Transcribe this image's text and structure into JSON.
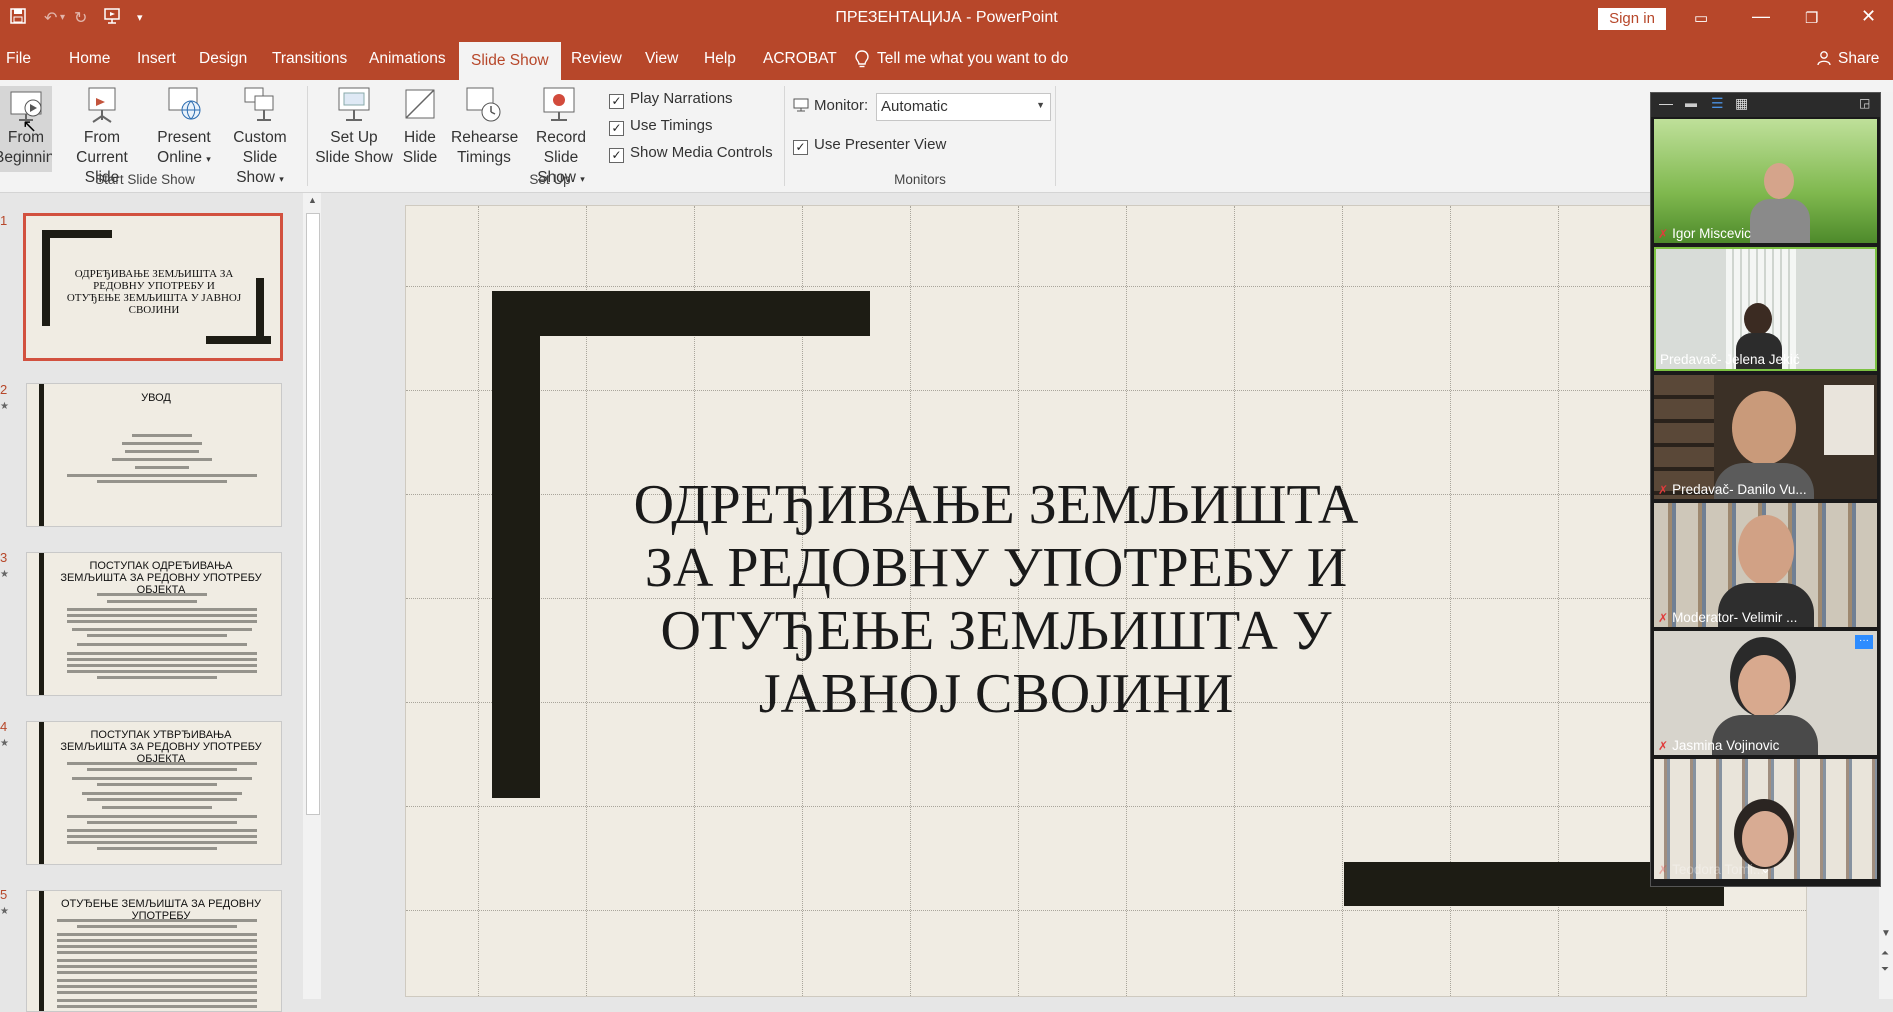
{
  "window": {
    "title": "ПРЕЗЕНТАЦИЈА  -  PowerPoint",
    "signin_label": "Sign in"
  },
  "tabs": [
    "File",
    "Home",
    "Insert",
    "Design",
    "Transitions",
    "Animations",
    "Slide Show",
    "Review",
    "View",
    "Help",
    "ACROBAT"
  ],
  "active_tab": "Slide Show",
  "tell_me": "Tell me what you want to do",
  "share_label": "Share",
  "ribbon": {
    "start_group": {
      "label": "Start Slide Show",
      "from_beginning": [
        "From",
        "Beginning"
      ],
      "from_current": [
        "From",
        "Current Slide"
      ],
      "present_online": [
        "Present",
        "Online"
      ],
      "custom_show": [
        "Custom Slide",
        "Show"
      ]
    },
    "setup_group": {
      "label": "Set Up",
      "setup_show": [
        "Set Up",
        "Slide Show"
      ],
      "hide_slide": [
        "Hide",
        "Slide"
      ],
      "rehearse": [
        "Rehearse",
        "Timings"
      ],
      "record": [
        "Record Slide",
        "Show"
      ],
      "play_narrations": "Play Narrations",
      "use_timings": "Use Timings",
      "show_media_controls": "Show Media Controls"
    },
    "monitors_group": {
      "label": "Monitors",
      "monitor_label": "Monitor:",
      "monitor_value": "Automatic",
      "presenter_view": "Use Presenter View"
    }
  },
  "thumbnails": [
    {
      "num": "1",
      "title": "ОДРЕЂИВАЊЕ ЗЕМЉИШТА ЗА РЕДОВНУ УПОТРЕБУ И ОТУЂЕЊЕ ЗЕМЉИШТА У ЈАВНОЈ СВОЈИНИ"
    },
    {
      "num": "2",
      "title": "УВОД"
    },
    {
      "num": "3",
      "title": "ПОСТУПАК ОДРЕЂИВАЊА ЗЕМЉИШТА ЗА РЕДОВНУ УПОТРЕБУ ОБЈЕКТА"
    },
    {
      "num": "4",
      "title": "ПОСТУПАК УТВРЂИВАЊА ЗЕМЉИШТА ЗА РЕДОВНУ УПОТРЕБУ ОБЈЕКТА"
    },
    {
      "num": "5",
      "title": "ОТУЂЕЊЕ ЗЕМЉИШТА ЗА РЕДОВНУ УПОТРЕБУ"
    }
  ],
  "slide": {
    "title": "ОДРЕЂИВАЊЕ ЗЕМЉИШТА ЗА РЕДОВНУ УПОТРЕБУ И ОТУЂЕЊЕ ЗЕМЉИШТА У ЈАВНОЈ СВОЈИНИ"
  },
  "participants": [
    "Igor Miscevic",
    "Predavač- Jelena Jekić",
    "Predavač- Danilo Vu...",
    "Moderator- Velimir ...",
    "Jasmina Vojinovic",
    "Teodora Tomi..."
  ]
}
